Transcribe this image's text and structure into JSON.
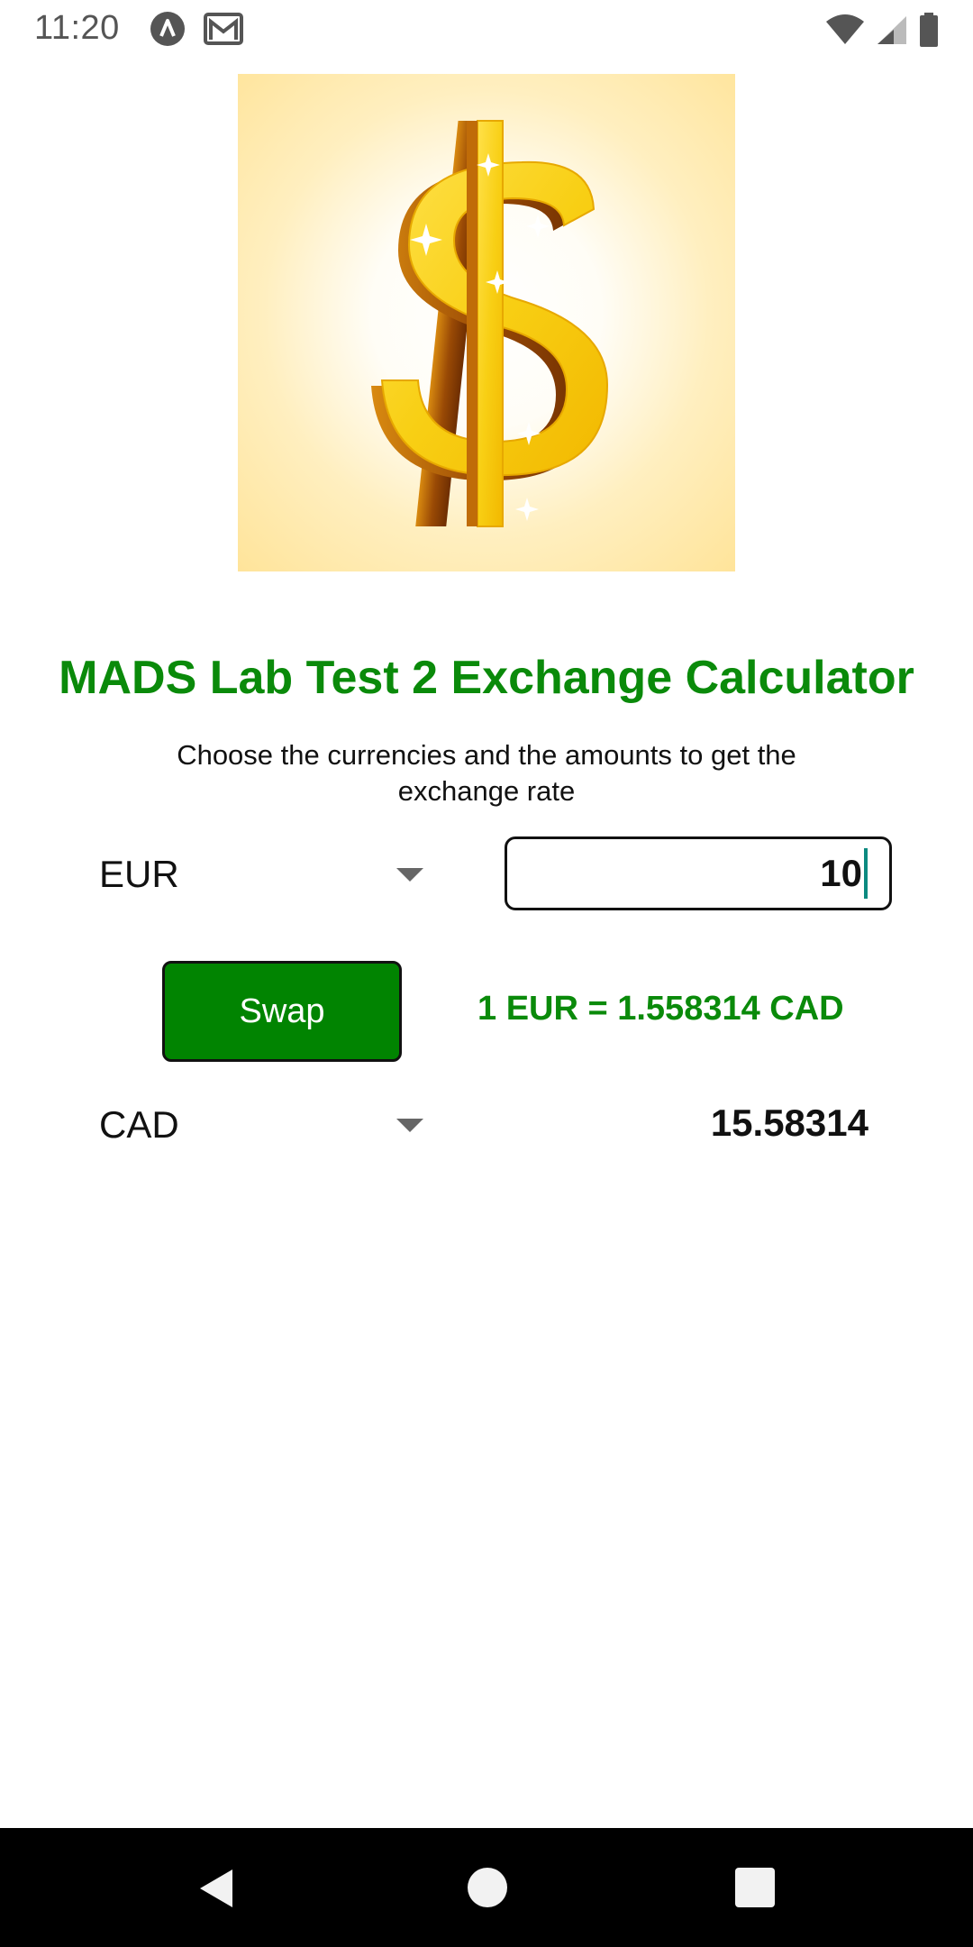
{
  "status_bar": {
    "time": "11:20",
    "icons": [
      "app-a-icon",
      "gmail-icon",
      "wifi-icon",
      "cellular-signal-icon",
      "battery-icon"
    ]
  },
  "hero": {
    "icon": "dollar-sign-icon",
    "colors": {
      "gold": "#f9d21a",
      "bronze": "#a85a05",
      "background": "#ffe7a0"
    }
  },
  "title": "MADS Lab Test 2 Exchange Calculator",
  "subtitle": "Choose the currencies and the amounts to get the exchange rate",
  "from_currency": {
    "selected": "EUR",
    "amount": "10"
  },
  "swap_button": {
    "label": "Swap"
  },
  "rate": "1 EUR = 1.558314 CAD",
  "to_currency": {
    "selected": "CAD",
    "result": "15.58314"
  },
  "colors": {
    "accent_green": "#0a8a0a",
    "button_green": "#018401",
    "caret": "#0b8a80"
  }
}
